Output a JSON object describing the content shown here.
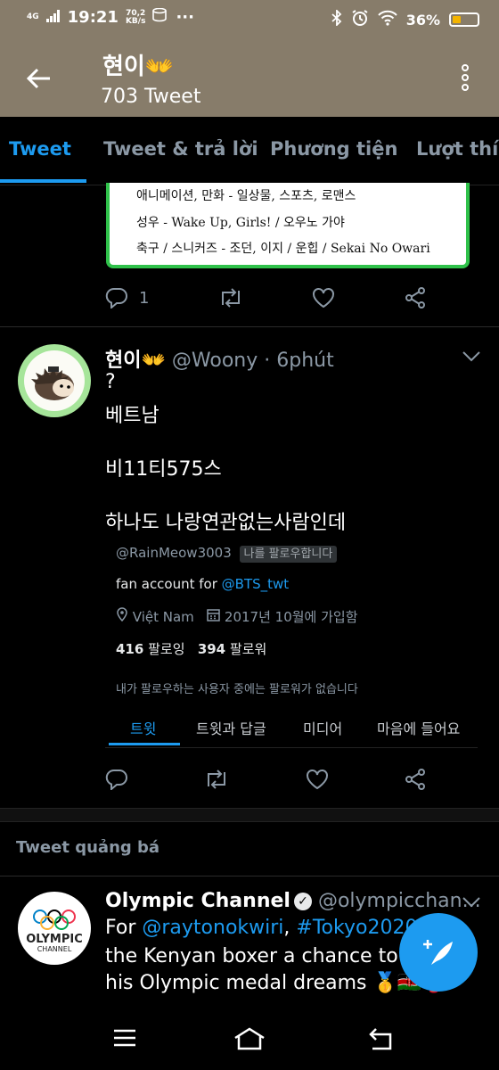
{
  "status_bar": {
    "network": "4G",
    "time": "19:21",
    "speed": "70,2",
    "speed_unit": "KB/s",
    "overflow": "···",
    "battery_percent": "36%",
    "battery_level": 0.36
  },
  "header": {
    "title": "현이",
    "title_emoji": "👐",
    "tweet_count": "703 Tweet"
  },
  "tabs": [
    {
      "label": "Tweet",
      "active": true
    },
    {
      "label": "Tweet & trả lời",
      "active": false
    },
    {
      "label": "Phương tiện",
      "active": false
    },
    {
      "label": "Lượt thíc",
      "active": false
    }
  ],
  "prev_tweet": {
    "card_lines": [
      "애니메이션, 만화 - 일상물, 스포츠, 로맨스",
      "성우 - Wake Up, Girls! / 오우노 가야",
      "축구 / 스니커즈 - 조던, 이지 / 운힙 / Sekai No Owari"
    ],
    "reply_count": "1"
  },
  "tweet": {
    "name": "현이",
    "name_emoji": "👐",
    "handle": "@Woony",
    "time": "· 6phút",
    "lines": [
      "?",
      "베트남",
      "비11티575스",
      "하나도 나랑연관없는사람인데"
    ],
    "embed": {
      "handle": "@RainMeow3003",
      "follows_badge": "나를 팔로우합니다",
      "bio_prefix": "fan account for ",
      "bio_link": "@BTS_twt",
      "location": "Việt Nam",
      "joined": "2017년 10월에 가입함",
      "following_count": "416",
      "following_label": "팔로잉",
      "followers_count": "394",
      "followers_label": "팔로워",
      "mutuals": "내가 팔로우하는 사용자 중에는 팔로워가 없습니다",
      "tabs": [
        "트윗",
        "트윗과 답글",
        "미디어",
        "마음에 들어요"
      ]
    }
  },
  "promoted_label": "Tweet quảng bá",
  "promoted": {
    "avatar_text": "OLYMPIC",
    "avatar_subtext": "CHANNEL",
    "name": "Olympic Channel",
    "handle": "@olympicchan...",
    "text_prefix": "For ",
    "mention": "@raytonokwiri",
    "hashtag": "#Tokyo2020",
    "text_suffix": " g",
    "line2": "the Kenyan boxer a chance to ac",
    "line3": "his Olympic medal dreams 🥇🇰🇪🥊"
  },
  "colors": {
    "header_bg": "#877c6a",
    "accent": "#1d9bf0",
    "muted": "#8b98a5",
    "card_border": "#2fc14a"
  }
}
